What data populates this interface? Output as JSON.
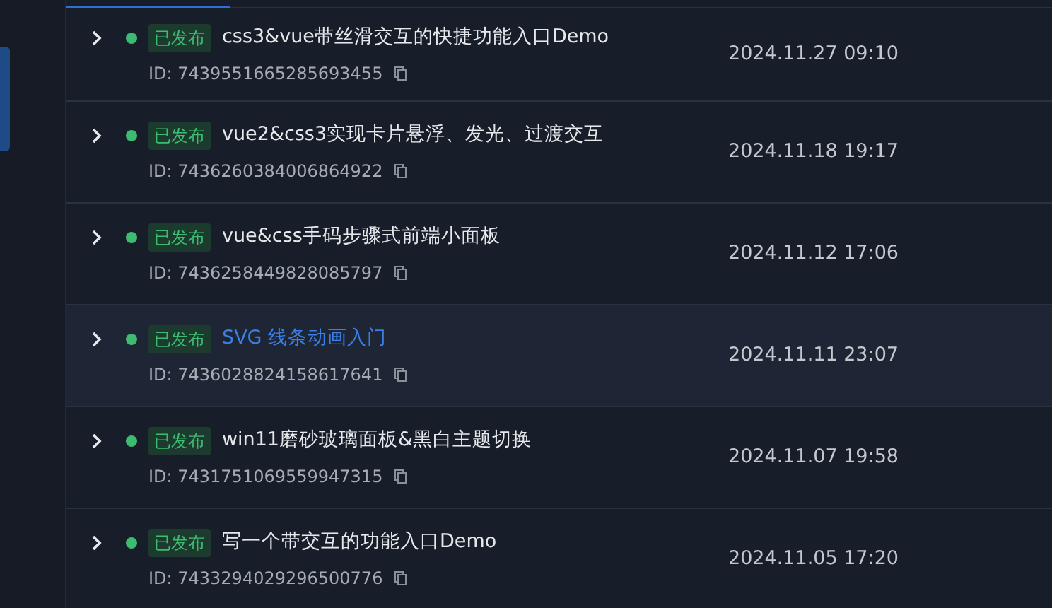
{
  "sidebar": {
    "items": [
      {
        "selected": true
      }
    ]
  },
  "tabs": [
    {
      "selected": true
    }
  ],
  "articles": [
    {
      "status": "已发布",
      "title": "css3&vue带丝滑交互的快捷功能入口Demo",
      "id": "ID: 7439551665285693455",
      "date": "2024.11.27 09:10",
      "hovered": false
    },
    {
      "status": "已发布",
      "title": "vue2&css3实现卡片悬浮、发光、过渡交互",
      "id": "ID: 7436260384006864922",
      "date": "2024.11.18 19:17",
      "hovered": false
    },
    {
      "status": "已发布",
      "title": "vue&css手码步骤式前端小面板",
      "id": "ID: 7436258449828085797",
      "date": "2024.11.12 17:06",
      "hovered": false
    },
    {
      "status": "已发布",
      "title": "SVG 线条动画入门",
      "id": "ID: 7436028824158617641",
      "date": "2024.11.11 23:07",
      "hovered": true
    },
    {
      "status": "已发布",
      "title": "win11磨砂玻璃面板&黑白主题切换",
      "id": "ID: 7431751069559947315",
      "date": "2024.11.07 19:58",
      "hovered": false
    },
    {
      "status": "已发布",
      "title": "写一个带交互的功能入口Demo",
      "id": "ID: 7433294029296500776",
      "date": "2024.11.05 17:20",
      "hovered": false
    }
  ]
}
